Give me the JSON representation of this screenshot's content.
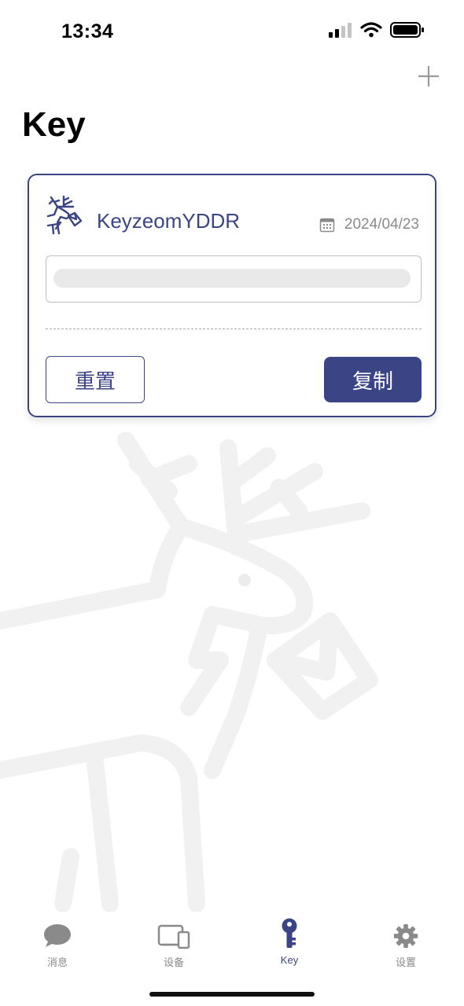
{
  "status_bar": {
    "time": "13:34"
  },
  "page": {
    "title": "Key"
  },
  "card": {
    "name": "KeyzeomYDDR",
    "date": "2024/04/23",
    "reset_label": "重置",
    "copy_label": "复制"
  },
  "tabs": [
    {
      "label": "消息",
      "icon": "chat-bubble-icon",
      "active": false
    },
    {
      "label": "设备",
      "icon": "devices-icon",
      "active": false
    },
    {
      "label": "Key",
      "icon": "key-icon",
      "active": true
    },
    {
      "label": "设置",
      "icon": "gear-icon",
      "active": false
    }
  ],
  "colors": {
    "accent": "#3b4586",
    "inactive": "#8a8a8a",
    "watermark": "#f1f1f1"
  }
}
